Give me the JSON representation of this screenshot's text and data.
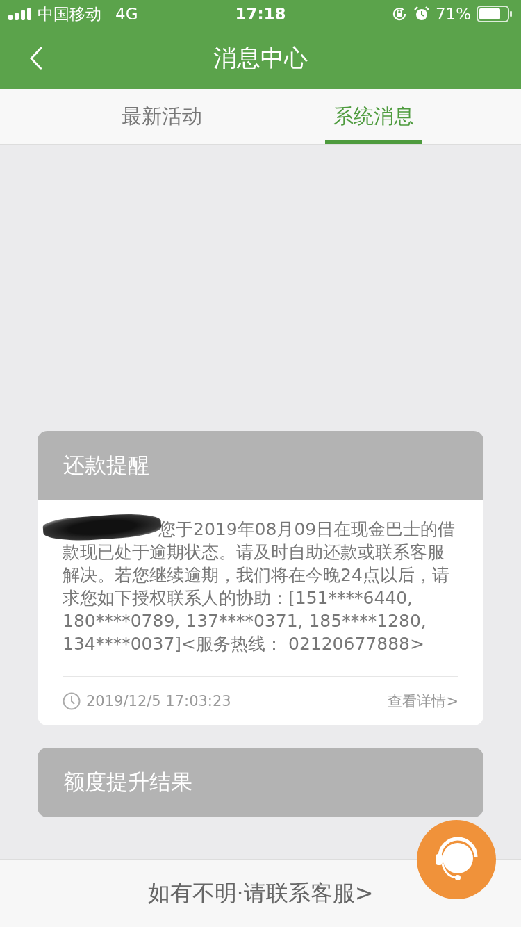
{
  "status_bar": {
    "carrier": "中国移动",
    "network": "4G",
    "time": "17:18",
    "battery": "71%"
  },
  "nav": {
    "title": "消息中心"
  },
  "tabs": [
    {
      "label": "最新活动",
      "selected": false
    },
    {
      "label": "系统消息",
      "selected": true
    }
  ],
  "messages": [
    {
      "title": "还款提醒",
      "redacted": true,
      "body": "您于2019年08月09日在现金巴士的借款现已处于逾期状态。请及时自助还款或联系客服解决。若您继续逾期，我们将在今晚24点以后，请求您如下授权联系人的协助：[151****6440, 180****0789, 137****0371, 185****1280, 134****0037]<服务热线： 02120677888>",
      "time": "2019/12/5 17:03:23",
      "link": "查看详情>"
    },
    {
      "title": "额度提升结果"
    }
  ],
  "footer": {
    "text": "如有不明·请联系客服>"
  }
}
